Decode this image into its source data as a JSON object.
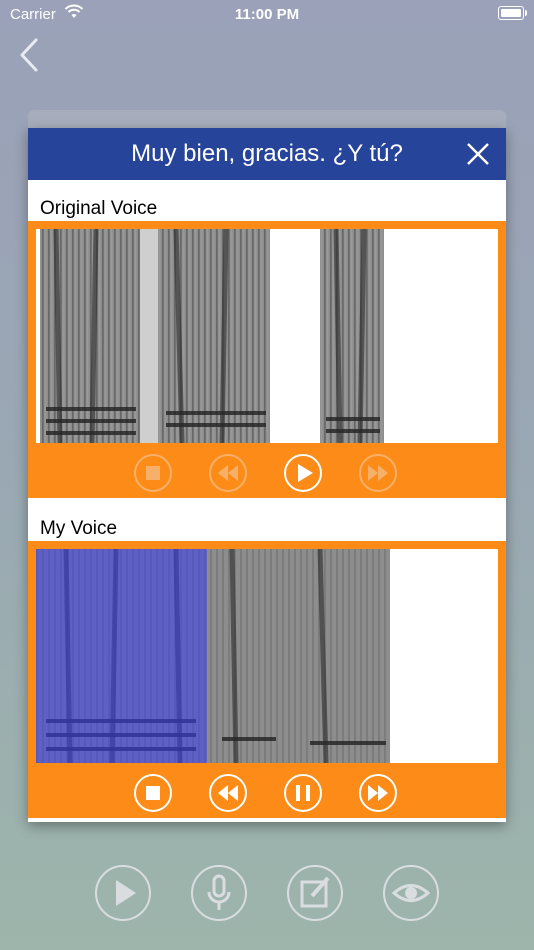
{
  "status_bar": {
    "carrier": "Carrier",
    "time": "11:00 PM"
  },
  "nav": {
    "back_icon": "chevron-left-icon"
  },
  "dialog": {
    "title": "Muy bien, gracias. ¿Y tú?",
    "close_icon": "close-icon",
    "original": {
      "label": "Original Voice",
      "controls": [
        {
          "name": "stop-button",
          "icon": "stop-icon",
          "enabled": false
        },
        {
          "name": "rewind-button",
          "icon": "rewind-icon",
          "enabled": false
        },
        {
          "name": "play-button",
          "icon": "play-icon",
          "enabled": true
        },
        {
          "name": "fast-forward-button",
          "icon": "fast-forward-icon",
          "enabled": false
        }
      ]
    },
    "mine": {
      "label": "My Voice",
      "playback_progress": 0.37,
      "controls": [
        {
          "name": "stop-button",
          "icon": "stop-icon",
          "enabled": true
        },
        {
          "name": "rewind-button",
          "icon": "rewind-icon",
          "enabled": true
        },
        {
          "name": "pause-button",
          "icon": "pause-icon",
          "enabled": true
        },
        {
          "name": "fast-forward-button",
          "icon": "fast-forward-icon",
          "enabled": true
        }
      ]
    }
  },
  "toolbar": [
    {
      "name": "play-button",
      "icon": "play-icon"
    },
    {
      "name": "record-button",
      "icon": "microphone-icon"
    },
    {
      "name": "edit-button",
      "icon": "edit-icon"
    },
    {
      "name": "view-button",
      "icon": "eye-icon"
    }
  ],
  "colors": {
    "header": "#27449b",
    "accent": "#fc8c17",
    "highlight": "#3a3cf0"
  }
}
